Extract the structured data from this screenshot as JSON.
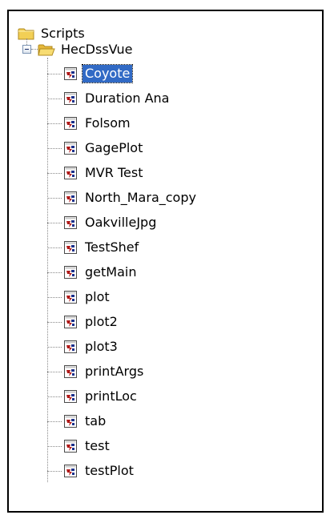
{
  "tree": {
    "root": {
      "label": "Scripts",
      "icon": "folder-icon"
    },
    "folder": {
      "label": "HecDssVue",
      "icon": "folder-open-icon",
      "expanded": true
    },
    "selected_item": "Coyote",
    "items": [
      {
        "label": "Coyote"
      },
      {
        "label": "Duration Ana"
      },
      {
        "label": "Folsom"
      },
      {
        "label": "GagePlot"
      },
      {
        "label": "MVR Test"
      },
      {
        "label": "North_Mara_copy"
      },
      {
        "label": "OakvilleJpg"
      },
      {
        "label": "TestShef"
      },
      {
        "label": "getMain"
      },
      {
        "label": "plot"
      },
      {
        "label": "plot2"
      },
      {
        "label": "plot3"
      },
      {
        "label": "printArgs"
      },
      {
        "label": "printLoc"
      },
      {
        "label": "tab"
      },
      {
        "label": "test"
      },
      {
        "label": "testPlot"
      }
    ]
  },
  "colors": {
    "selection": "#316ac5",
    "folder": "#f2cf55",
    "border": "#000000"
  }
}
